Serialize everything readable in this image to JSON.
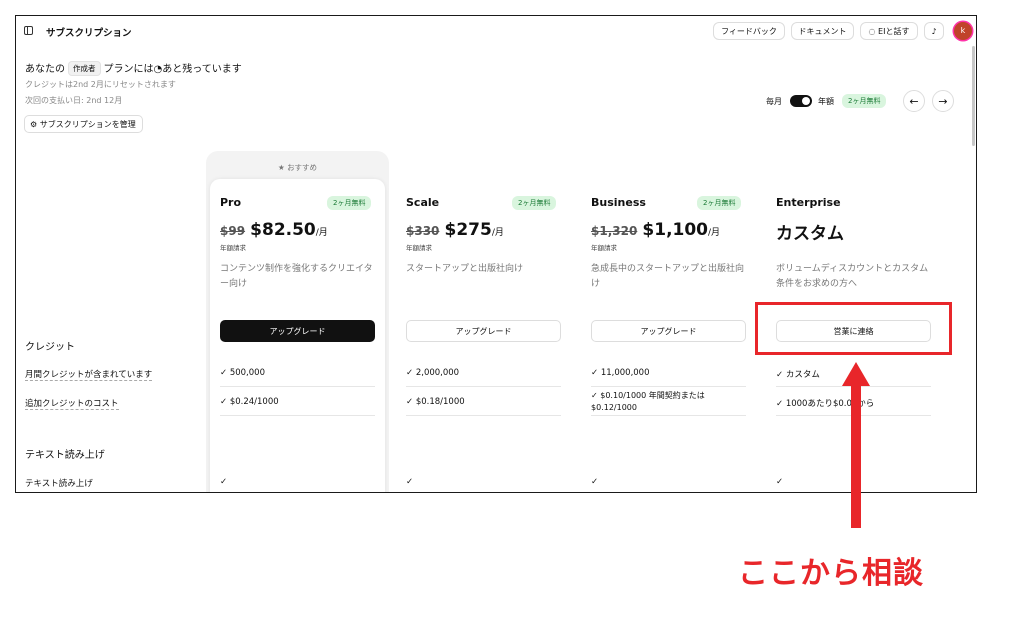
{
  "topbar": {
    "title": "サブスクリプション",
    "feedback": "フィードバック",
    "docs": "ドキュメント",
    "talk_ai": "EIと話す",
    "avatar_letter": "k"
  },
  "header": {
    "plan_prefix": "あなたの",
    "plan_chip": "作成者",
    "plan_suffix": "プランには",
    "plan_remaining": "あと残っています",
    "reset_note": "クレジットは2nd 2月にリセットされます",
    "next_payment": "次回の支払い日: 2nd 12月",
    "manage_button": "サブスクリプションを管理"
  },
  "billing_toggle": {
    "monthly": "毎月",
    "yearly": "年額",
    "badge": "2ヶ月無料"
  },
  "recommended": "おすすめ",
  "plans": [
    {
      "name": "Pro",
      "badge": "2ヶ月無料",
      "old_price": "$99",
      "price": "$82.50",
      "per": "/月",
      "billing": "年額請求",
      "desc": "コンテンツ制作を強化するクリエイター向け",
      "button": "アップグレード",
      "credits": "500,000",
      "extra_cost": "$0.24/1000"
    },
    {
      "name": "Scale",
      "badge": "2ヶ月無料",
      "old_price": "$330",
      "price": "$275",
      "per": "/月",
      "billing": "年額請求",
      "desc": "スタートアップと出版社向け",
      "button": "アップグレード",
      "credits": "2,000,000",
      "extra_cost": "$0.18/1000"
    },
    {
      "name": "Business",
      "badge": "2ヶ月無料",
      "old_price": "$1,320",
      "price": "$1,100",
      "per": "/月",
      "billing": "年額請求",
      "desc": "急成長中のスタートアップと出版社向け",
      "button": "アップグレード",
      "credits": "11,000,000",
      "extra_cost": "$0.10/1000 年間契約または $0.12/1000"
    },
    {
      "name": "Enterprise",
      "price": "カスタム",
      "desc": "ボリュームディスカウントとカスタム条件をお求めの方へ",
      "button": "営業に連絡",
      "credits": "カスタム",
      "extra_cost": "1000あたり$0.03から"
    }
  ],
  "rows": {
    "credits_section": "クレジット",
    "included_credits": "月間クレジットが含まれています",
    "extra_credit_cost": "追加クレジットのコスト",
    "tts_section": "テキスト読み上げ",
    "tts_row": "テキスト読み上げ",
    "check": "✓"
  },
  "annotation": {
    "text": "ここから相談",
    "color": "#e8262a"
  }
}
